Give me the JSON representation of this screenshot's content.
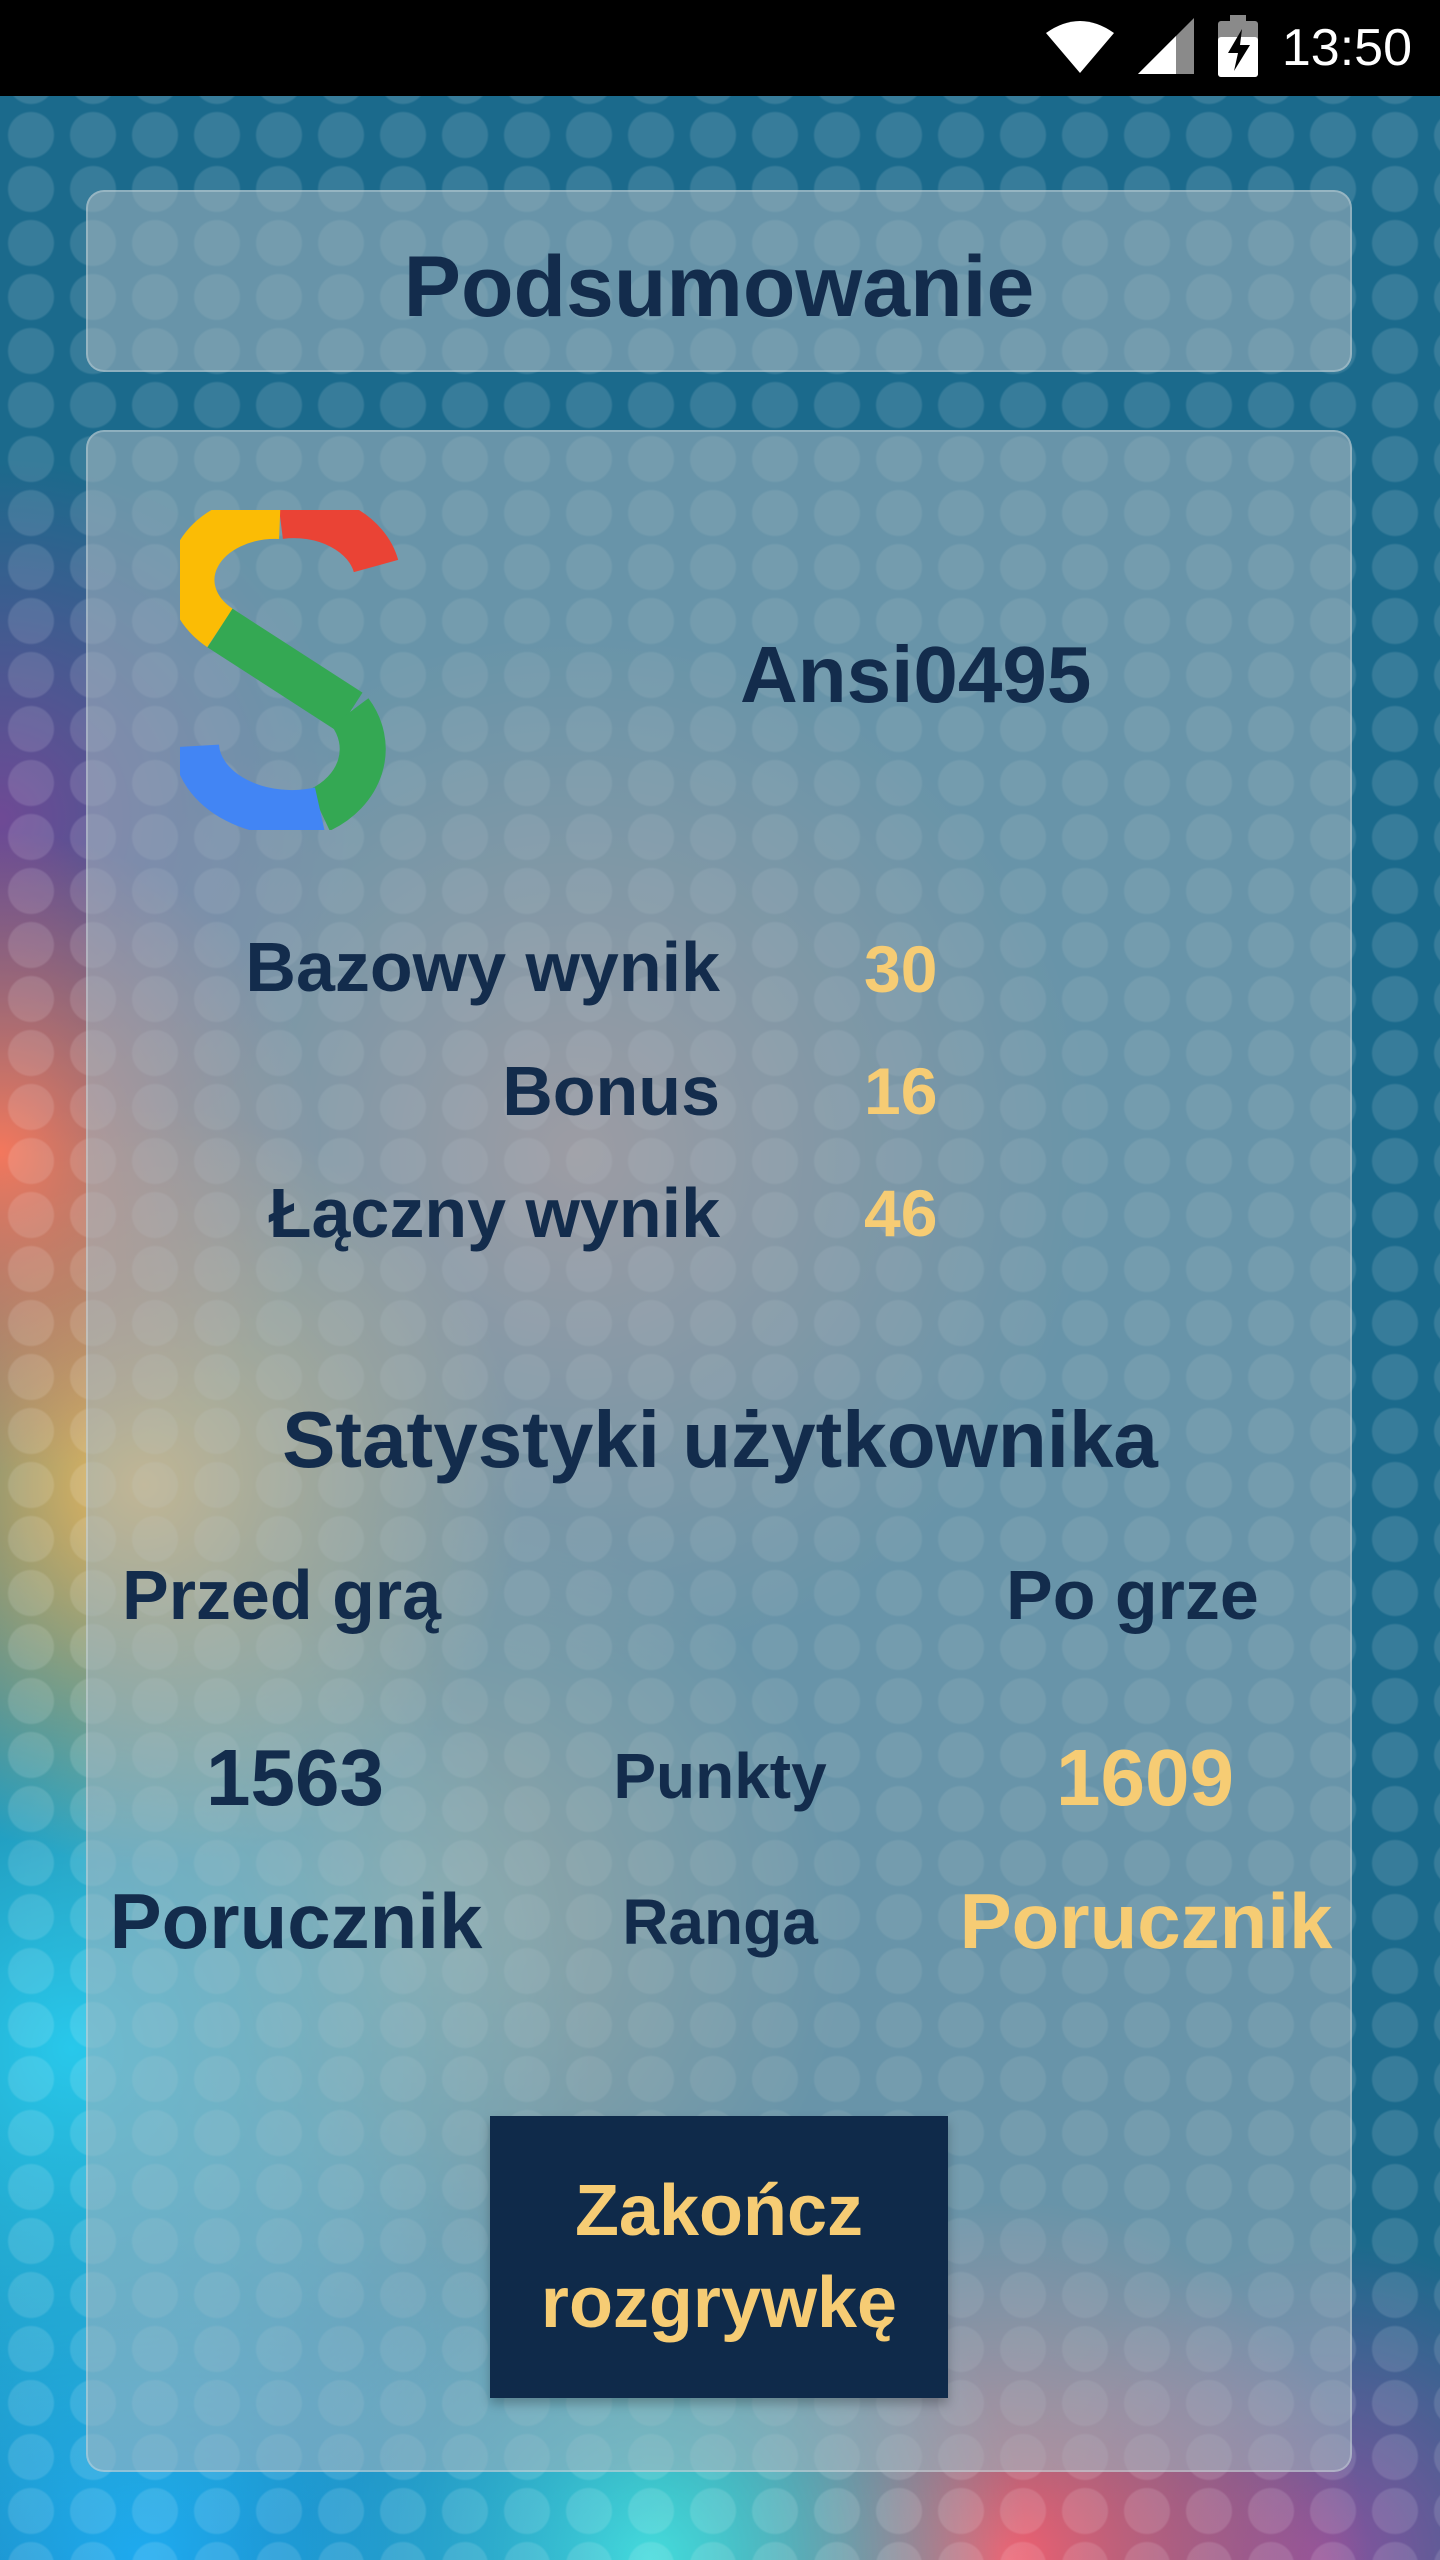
{
  "status_bar": {
    "time": "13:50",
    "icons": [
      "wifi-icon",
      "cell-signal-icon",
      "battery-charging-icon"
    ]
  },
  "header": {
    "title": "Podsumowanie"
  },
  "player": {
    "username": "Ansi0495",
    "logo": "google-s-logo"
  },
  "score": {
    "rows": [
      {
        "label": "Bazowy wynik",
        "value": "30"
      },
      {
        "label": "Bonus",
        "value": "16"
      },
      {
        "label": "Łączny wynik",
        "value": "46"
      }
    ]
  },
  "stats": {
    "heading": "Statystyki użytkownika",
    "before_label": "Przed grą",
    "after_label": "Po grze",
    "points_label": "Punkty",
    "rank_label": "Ranga",
    "points_before": "1563",
    "points_after": "1609",
    "rank_before": "Porucznik",
    "rank_after": "Porucznik"
  },
  "end_button": {
    "line1": "Zakończ",
    "line2": "rozgrywkę"
  },
  "colors": {
    "text_dark": "#132c4c",
    "text_gold": "#f6cc74",
    "button_bg": "#0f2a4a",
    "background": "#1b6a8c"
  }
}
